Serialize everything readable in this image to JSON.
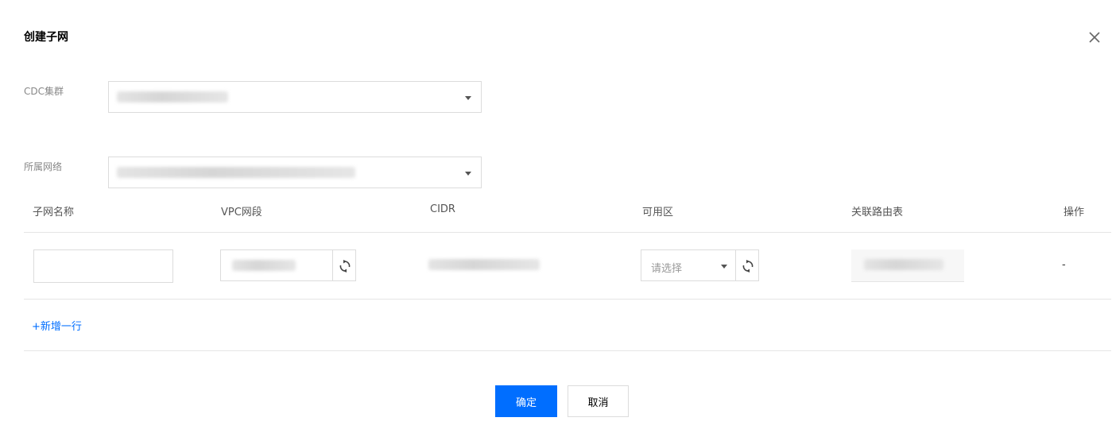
{
  "dialog": {
    "title": "创建子网",
    "close_icon": "close-icon"
  },
  "form": {
    "cdc_label": "CDC集群",
    "vpc_label": "所属网络"
  },
  "table": {
    "headers": [
      "子网名称",
      "VPC网段",
      "CIDR",
      "可用区",
      "关联路由表",
      "操作"
    ],
    "row": {
      "subnet_name": "",
      "zone_placeholder": "请选择",
      "action": "-"
    },
    "add_row": "+新增一行"
  },
  "footer": {
    "confirm": "确定",
    "cancel": "取消"
  },
  "colors": {
    "primary": "#006eff",
    "border": "#dcdcdc",
    "divider": "#e5e5e5"
  }
}
